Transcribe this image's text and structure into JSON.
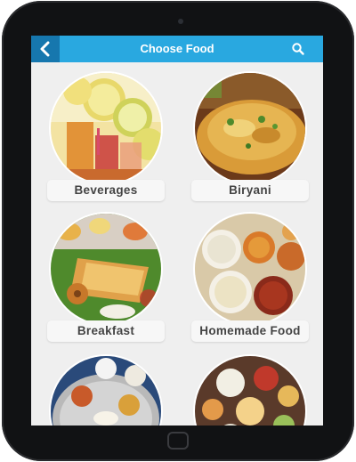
{
  "header": {
    "title": "Choose Food",
    "back_icon": "chevron-left-icon",
    "search_icon": "search-icon"
  },
  "colors": {
    "accent": "#29a8e0",
    "back_button": "#1677ae",
    "screen_background": "#efefef",
    "label_text": "#444444"
  },
  "categories": [
    {
      "label": "Beverages"
    },
    {
      "label": "Biryani"
    },
    {
      "label": "Breakfast"
    },
    {
      "label": "Homemade Food"
    },
    {
      "label": ""
    },
    {
      "label": ""
    }
  ]
}
